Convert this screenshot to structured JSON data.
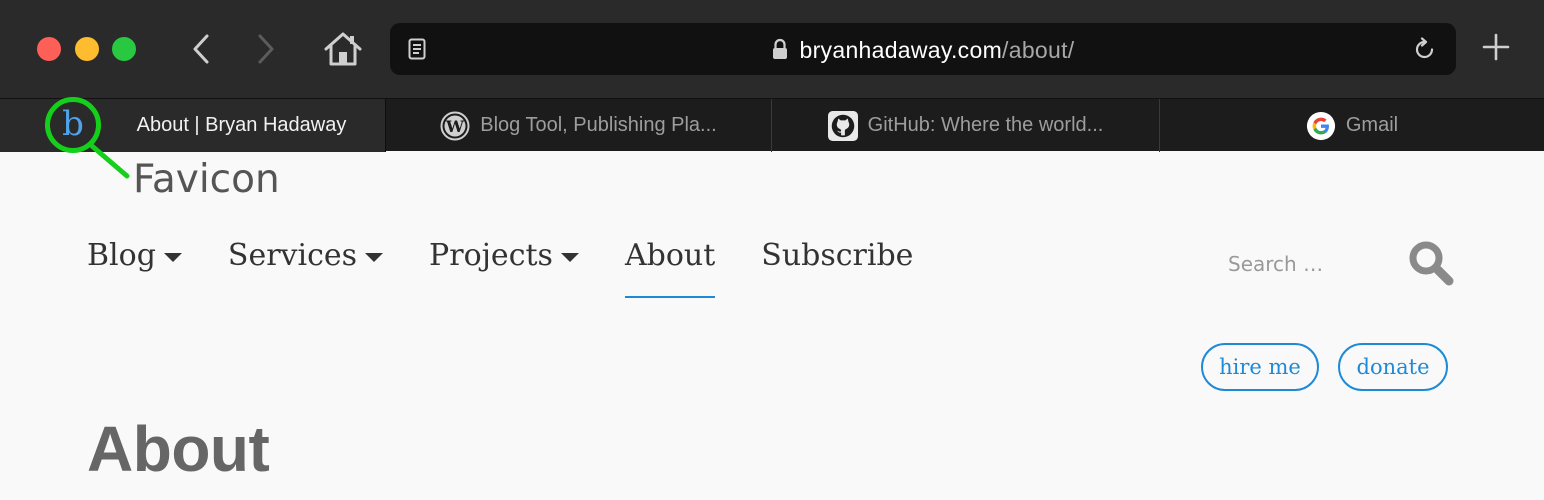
{
  "browser": {
    "url_host": "bryanhadaway.com",
    "url_path": "/about/",
    "icons": [
      "close-icon",
      "minimize-icon",
      "zoom-icon",
      "back-icon",
      "forward-icon",
      "home-icon",
      "reader-icon",
      "lock-icon",
      "reload-icon",
      "new-tab-icon"
    ]
  },
  "tabs": [
    {
      "label": "About | Bryan Hadaway",
      "active": true,
      "icon": "favicon-b"
    },
    {
      "label": "Blog Tool, Publishing Pla...",
      "active": false,
      "icon": "wordpress-icon"
    },
    {
      "label": "GitHub: Where the world...",
      "active": false,
      "icon": "github-icon"
    },
    {
      "label": "Gmail",
      "active": false,
      "icon": "google-icon"
    }
  ],
  "annotation": {
    "favicon_glyph": "b",
    "label": "Favicon",
    "color": "#15d01a"
  },
  "site_nav": {
    "items": [
      {
        "label": "Blog",
        "dropdown": true
      },
      {
        "label": "Services",
        "dropdown": true
      },
      {
        "label": "Projects",
        "dropdown": true
      },
      {
        "label": "About",
        "dropdown": false,
        "active": true
      },
      {
        "label": "Subscribe",
        "dropdown": false
      }
    ]
  },
  "search": {
    "placeholder": "Search …",
    "value": ""
  },
  "buttons": {
    "hire_me": "hire me",
    "donate": "donate"
  },
  "page": {
    "title": "About"
  },
  "colors": {
    "accent": "#1e8ad6",
    "chrome_bg": "#2a2a2a",
    "tab_bar_bg": "#1c1c1c"
  }
}
